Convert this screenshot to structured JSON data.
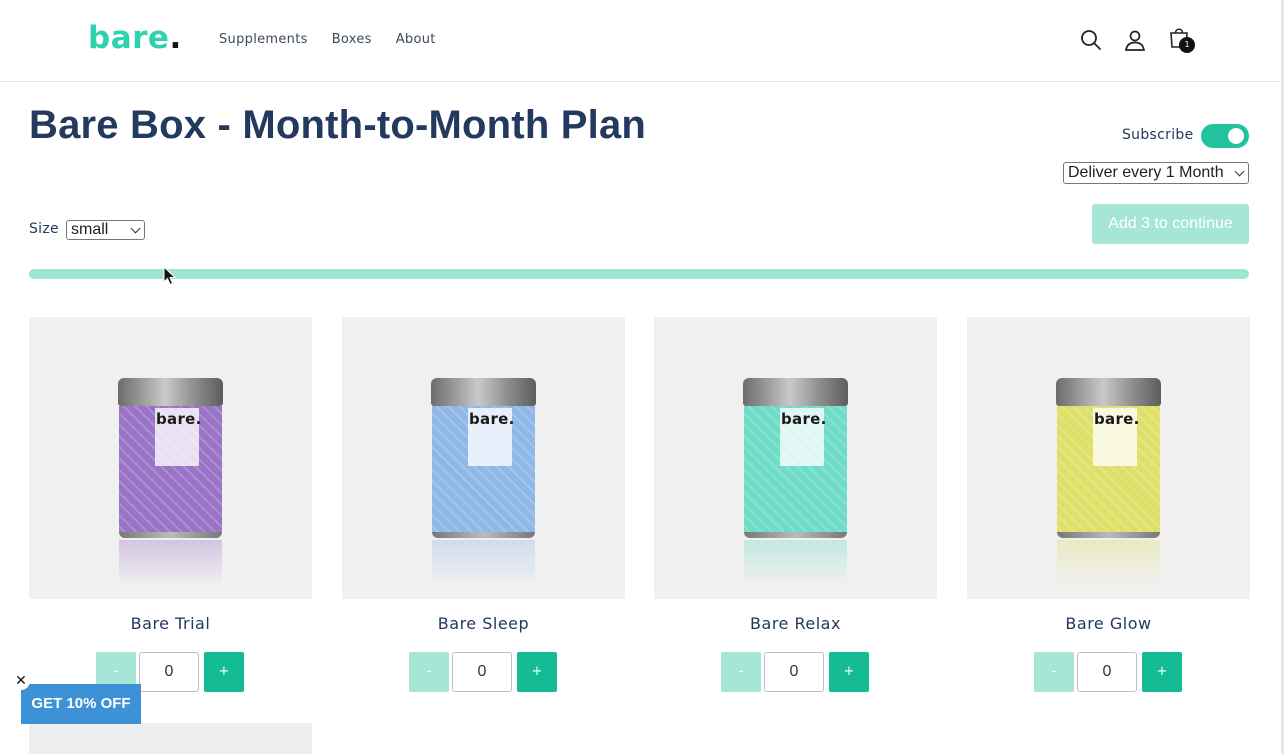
{
  "header": {
    "logo_text": "bare",
    "logo_dot": ".",
    "nav": [
      "Supplements",
      "Boxes",
      "About"
    ],
    "cart_count": "1",
    "icons": [
      "search-icon",
      "account-icon",
      "cart-icon"
    ]
  },
  "page": {
    "title": "Bare Box - Month-to-Month Plan",
    "subscribe_label": "Subscribe",
    "subscribe_on": true,
    "deliver_selected": "Deliver every 1 Month",
    "size_label": "Size",
    "size_selected": "small",
    "add_button": "Add 3 to continue",
    "progress_fraction": 0
  },
  "products": [
    {
      "name": "Bare Trial",
      "qty": "0",
      "tin_color": "#9a74c6",
      "tin_brand": "bare.",
      "minus": "-",
      "plus": "+"
    },
    {
      "name": "Bare Sleep",
      "qty": "0",
      "tin_color": "#8fb8e8",
      "tin_brand": "bare.",
      "minus": "-",
      "plus": "+"
    },
    {
      "name": "Bare Relax",
      "qty": "0",
      "tin_color": "#6edcc6",
      "tin_brand": "bare.",
      "minus": "-",
      "plus": "+"
    },
    {
      "name": "Bare Glow",
      "qty": "0",
      "tin_color": "#dfe06a",
      "tin_brand": "bare.",
      "minus": "-",
      "plus": "+"
    }
  ],
  "promo": {
    "label": "GET 10% OFF",
    "close": "✕"
  },
  "colors": {
    "accent": "#21c29c",
    "accent_light": "#a6e6d7",
    "title": "#23395d",
    "promo": "#3d91d6"
  }
}
